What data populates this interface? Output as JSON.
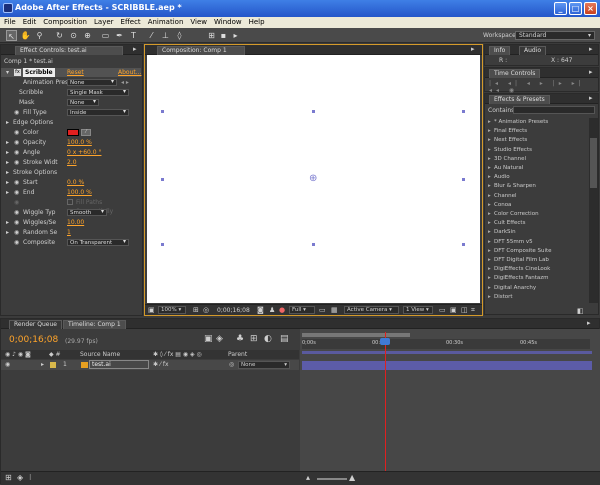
{
  "window": {
    "title": "Adobe After Effects - SCRIBBLE.aep *"
  },
  "menu": [
    "File",
    "Edit",
    "Composition",
    "Layer",
    "Effect",
    "Animation",
    "View",
    "Window",
    "Help"
  ],
  "workspace": {
    "label": "Workspace:",
    "value": "Standard"
  },
  "effect_controls": {
    "tab": "Effect Controls: test.ai",
    "breadcrumb": "Comp 1 * test.ai",
    "effect_name": "Scribble",
    "reset": "Reset",
    "about": "About...",
    "props": [
      {
        "label": "Animation Pres",
        "value": "None"
      },
      {
        "label": "Scribble",
        "value": "Single Mask"
      },
      {
        "label": "Mask",
        "value": "None"
      },
      {
        "label": "Fill Type",
        "value": "Inside"
      },
      {
        "label": "Edge Options",
        "value": ""
      },
      {
        "label": "Color",
        "value": ""
      },
      {
        "label": "Opacity",
        "value": "100.0 %"
      },
      {
        "label": "Angle",
        "value": "0 x +60.0 °"
      },
      {
        "label": "Stroke Widt",
        "value": "2.0"
      },
      {
        "label": "Stroke Options",
        "value": ""
      },
      {
        "label": "Start",
        "value": "0.0 %"
      },
      {
        "label": "End",
        "value": "100.0 %"
      },
      {
        "label": "Fill Paths Sequentially",
        "value": ""
      },
      {
        "label": "Wiggle Typ",
        "value": "Smooth"
      },
      {
        "label": "Wiggles/Se",
        "value": "10.00"
      },
      {
        "label": "Random Se",
        "value": "1"
      },
      {
        "label": "Composite",
        "value": "On Transparent"
      }
    ],
    "color_swatch": "#e02020"
  },
  "composition": {
    "tab": "Composition: Comp 1",
    "zoom": "100%",
    "time": "0;00;16;08",
    "resolution": "Full",
    "camera": "Active Camera",
    "view": "1 View"
  },
  "info": {
    "tab1": "Info",
    "tab2": "Audio",
    "r": "R :",
    "x": "X : 647"
  },
  "time_controls": {
    "tab": "Time Controls"
  },
  "effects_presets": {
    "tab": "Effects & Presets",
    "contains_label": "Contains:",
    "items": [
      "* Animation Presets",
      "Final Effects",
      "Next Effects",
      "Studio Effects",
      "3D Channel",
      "Au Natural",
      "Audio",
      "Blur & Sharpen",
      "Channel",
      "Conoa",
      "Color Correction",
      "Cult Effects",
      "DarkSin",
      "DFT 55mm v5",
      "DFT Composite Suite",
      "DFT Digital Film Lab",
      "DigiEffects CineLook",
      "DigiEffects Fantazm",
      "Digital Anarchy",
      "Distort"
    ]
  },
  "timeline": {
    "tab1": "Render Queue",
    "tab2": "Timeline: Comp 1",
    "timecode": "0;00;16;08",
    "fps": "(29.97 fps)",
    "col_source": "Source Name",
    "col_parent": "Parent",
    "layer": {
      "num": "1",
      "name": "test.ai",
      "parent": "None"
    },
    "ruler": [
      "0;00s",
      "00:15s",
      "00:30s",
      "00:45s"
    ]
  },
  "colors": {
    "accent": "#ffa42a",
    "titlebar": "#2a5fd0",
    "playhead": "#e02020"
  }
}
